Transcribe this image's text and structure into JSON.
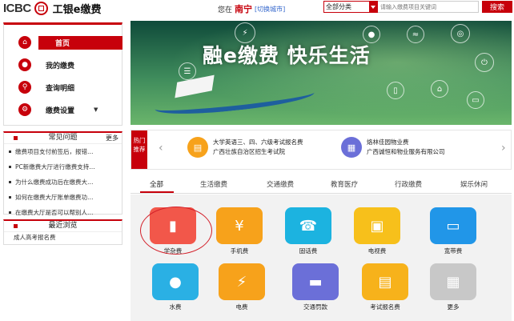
{
  "header": {
    "logo_text": "ICBC",
    "brand": "工银e缴费",
    "location_prefix": "您在",
    "city": "南宁",
    "switch_city": "[切换城市]",
    "category_select": "全部分类",
    "search_placeholder": "请输入缴费项目关键词",
    "search_button": "搜索"
  },
  "sidebar": {
    "items": [
      {
        "label": "首页",
        "icon": "home-icon",
        "active": true
      },
      {
        "label": "我的缴费",
        "icon": "user-icon"
      },
      {
        "label": "查询明细",
        "icon": "search-icon"
      },
      {
        "label": "缴费设置",
        "icon": "settings-icon",
        "caret": "▼"
      }
    ]
  },
  "faq": {
    "title": "常见问题",
    "more": "更多",
    "items": [
      "缴费项目支付前签后，报错…",
      "PC新缴费大厅进行缴费支持…",
      "为什么缴费成功后在缴费大…",
      "如何在缴费大厅账单缴费功…",
      "在缴费大厅是否可以帮别人…"
    ]
  },
  "recent": {
    "title": "最近浏览",
    "items": [
      "成人高考报名费"
    ]
  },
  "banner": {
    "title": "融e缴费  快乐生活"
  },
  "hot": {
    "tag": "热门推荐",
    "prev": "‹",
    "next": "›",
    "items": [
      {
        "line1": "大学英语三、四、六级考试报名费",
        "line2": "广西壮族自治区招生考试院",
        "icon": "certificate-icon"
      },
      {
        "line1": "烙林佳园物业费",
        "line2": "广西诚恒和物业服务有限公司",
        "icon": "building-icon"
      }
    ]
  },
  "tabs": [
    "全部",
    "生活缴费",
    "交通缴费",
    "教育医疗",
    "行政缴费",
    "娱乐休闲"
  ],
  "services": [
    {
      "label": "学杂费",
      "icon": "book-icon",
      "color": "#f2574a"
    },
    {
      "label": "手机费",
      "icon": "mobile-icon",
      "color": "#f7a21b"
    },
    {
      "label": "固话费",
      "icon": "telephone-icon",
      "color": "#1cb3e0"
    },
    {
      "label": "电视费",
      "icon": "tv-icon",
      "color": "#f7c01b"
    },
    {
      "label": "宽带费",
      "icon": "broadband-icon",
      "color": "#2196e8"
    },
    {
      "label": "水费",
      "icon": "water-icon",
      "color": "#2ab0e4"
    },
    {
      "label": "电费",
      "icon": "lightning-icon",
      "color": "#f7a21b"
    },
    {
      "label": "交通罚款",
      "icon": "car-icon",
      "color": "#6b6fd8"
    },
    {
      "label": "考试报名费",
      "icon": "exam-icon",
      "color": "#f7b21b"
    },
    {
      "label": "更多",
      "icon": "grid-icon",
      "color": "#c8c8c8"
    }
  ]
}
